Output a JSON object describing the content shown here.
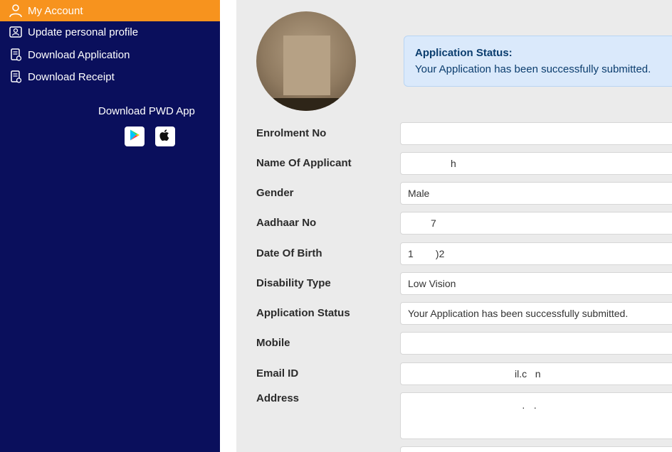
{
  "sidebar": {
    "items": [
      {
        "label": "My Account",
        "icon": "user-icon",
        "active": true
      },
      {
        "label": "Update personal profile",
        "icon": "profile-card-icon",
        "active": false
      },
      {
        "label": "Download Application",
        "icon": "document-download-icon",
        "active": false
      },
      {
        "label": "Download Receipt",
        "icon": "receipt-download-icon",
        "active": false
      }
    ],
    "app_title": "Download PWD App",
    "apps": [
      {
        "name": "Google Play",
        "icon": "google-play-icon"
      },
      {
        "name": "App Store",
        "icon": "apple-icon"
      }
    ]
  },
  "status": {
    "title": "Application Status:",
    "message": "Your Application has been successfully submitted."
  },
  "fields": [
    {
      "label": "Enrolment No",
      "value": ""
    },
    {
      "label": "Name Of Applicant",
      "value": "h"
    },
    {
      "label": "Gender",
      "value": "Male"
    },
    {
      "label": "Aadhaar No",
      "value": "7"
    },
    {
      "label": "Date Of Birth",
      "value": "1        )2"
    },
    {
      "label": "Disability Type",
      "value": "Low Vision"
    },
    {
      "label": "Application Status",
      "value": "Your Application has been successfully submitted."
    },
    {
      "label": "Mobile",
      "value": ""
    },
    {
      "label": "Email ID",
      "value": "il.c   n"
    },
    {
      "label": "Address",
      "value": "·   ·"
    }
  ],
  "colors": {
    "sidebar_bg": "#0a0f5c",
    "active_item_bg": "#f7931e",
    "status_box_bg": "#dae9fb",
    "main_bg": "#ebebeb"
  }
}
